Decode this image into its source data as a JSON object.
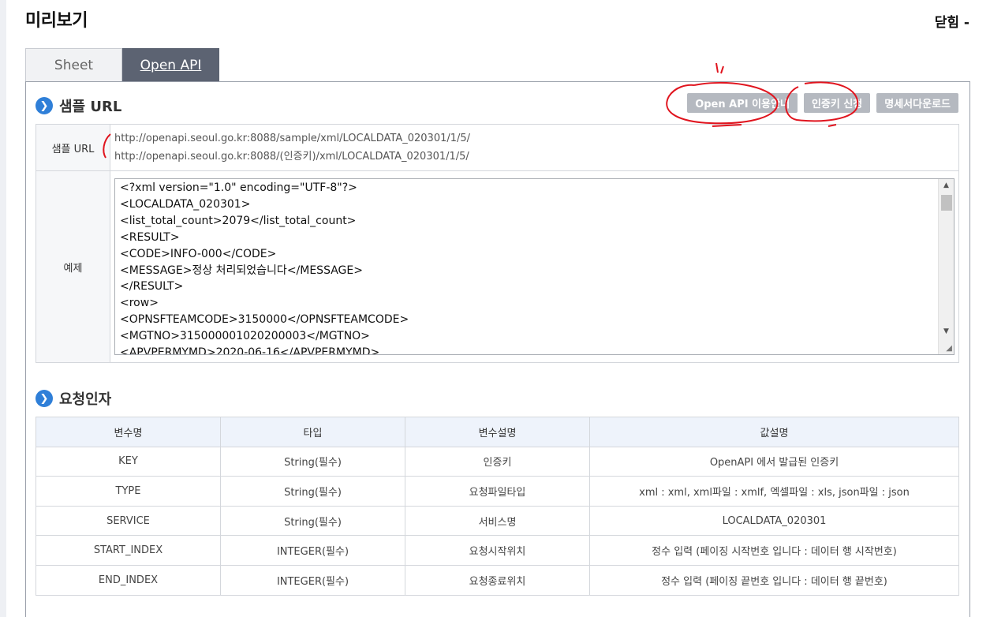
{
  "page": {
    "title": "미리보기",
    "close_label": "닫힘 -"
  },
  "tabs": [
    {
      "label": "Sheet",
      "active": false
    },
    {
      "label": "Open API",
      "active": true
    }
  ],
  "sample_section": {
    "title": "샘플 URL",
    "buttons": [
      "Open API 이용안내",
      "인증키 신청",
      "명세서다운로드"
    ],
    "url_label": "샘플 URL",
    "urls": [
      "http://openapi.seoul.go.kr:8088/sample/xml/LOCALDATA_020301/1/5/",
      "http://openapi.seoul.go.kr:8088/(인증키)/xml/LOCALDATA_020301/1/5/"
    ],
    "example_label": "예제",
    "example_code": [
      "<?xml version=\"1.0\" encoding=\"UTF-8\"?>",
      "<LOCALDATA_020301>",
      "<list_total_count>2079</list_total_count>",
      "<RESULT>",
      "<CODE>INFO-000</CODE>",
      "<MESSAGE>정상 처리되었습니다</MESSAGE>",
      "</RESULT>",
      "<row>",
      "<OPNSFTEAMCODE>3150000</OPNSFTEAMCODE>",
      "<MGTNO>315000001020200003</MGTNO>",
      "<APVPERMYMD>2020-06-16</APVPERMYMD>"
    ]
  },
  "request_section": {
    "title": "요청인자",
    "headers": [
      "변수명",
      "타입",
      "변수설명",
      "값설명"
    ],
    "rows": [
      [
        "KEY",
        "String(필수)",
        "인증키",
        "OpenAPI 에서 발급된 인증키"
      ],
      [
        "TYPE",
        "String(필수)",
        "요청파일타입",
        "xml : xml, xml파일 : xmlf, 엑셀파일 : xls, json파일 : json"
      ],
      [
        "SERVICE",
        "String(필수)",
        "서비스명",
        "LOCALDATA_020301"
      ],
      [
        "START_INDEX",
        "INTEGER(필수)",
        "요청시작위치",
        "정수 입력 (페이징 시작번호 입니다 : 데이터 행 시작번호)"
      ],
      [
        "END_INDEX",
        "INTEGER(필수)",
        "요청종료위치",
        "정수 입력 (페이징 끝번호 입니다 : 데이터 행 끝번호)"
      ]
    ]
  },
  "colors": {
    "accent_icon": "#2f7fd8",
    "active_tab": "#5c6372",
    "button_gray": "#b5b9c0",
    "annotation_red": "#e0141e"
  }
}
